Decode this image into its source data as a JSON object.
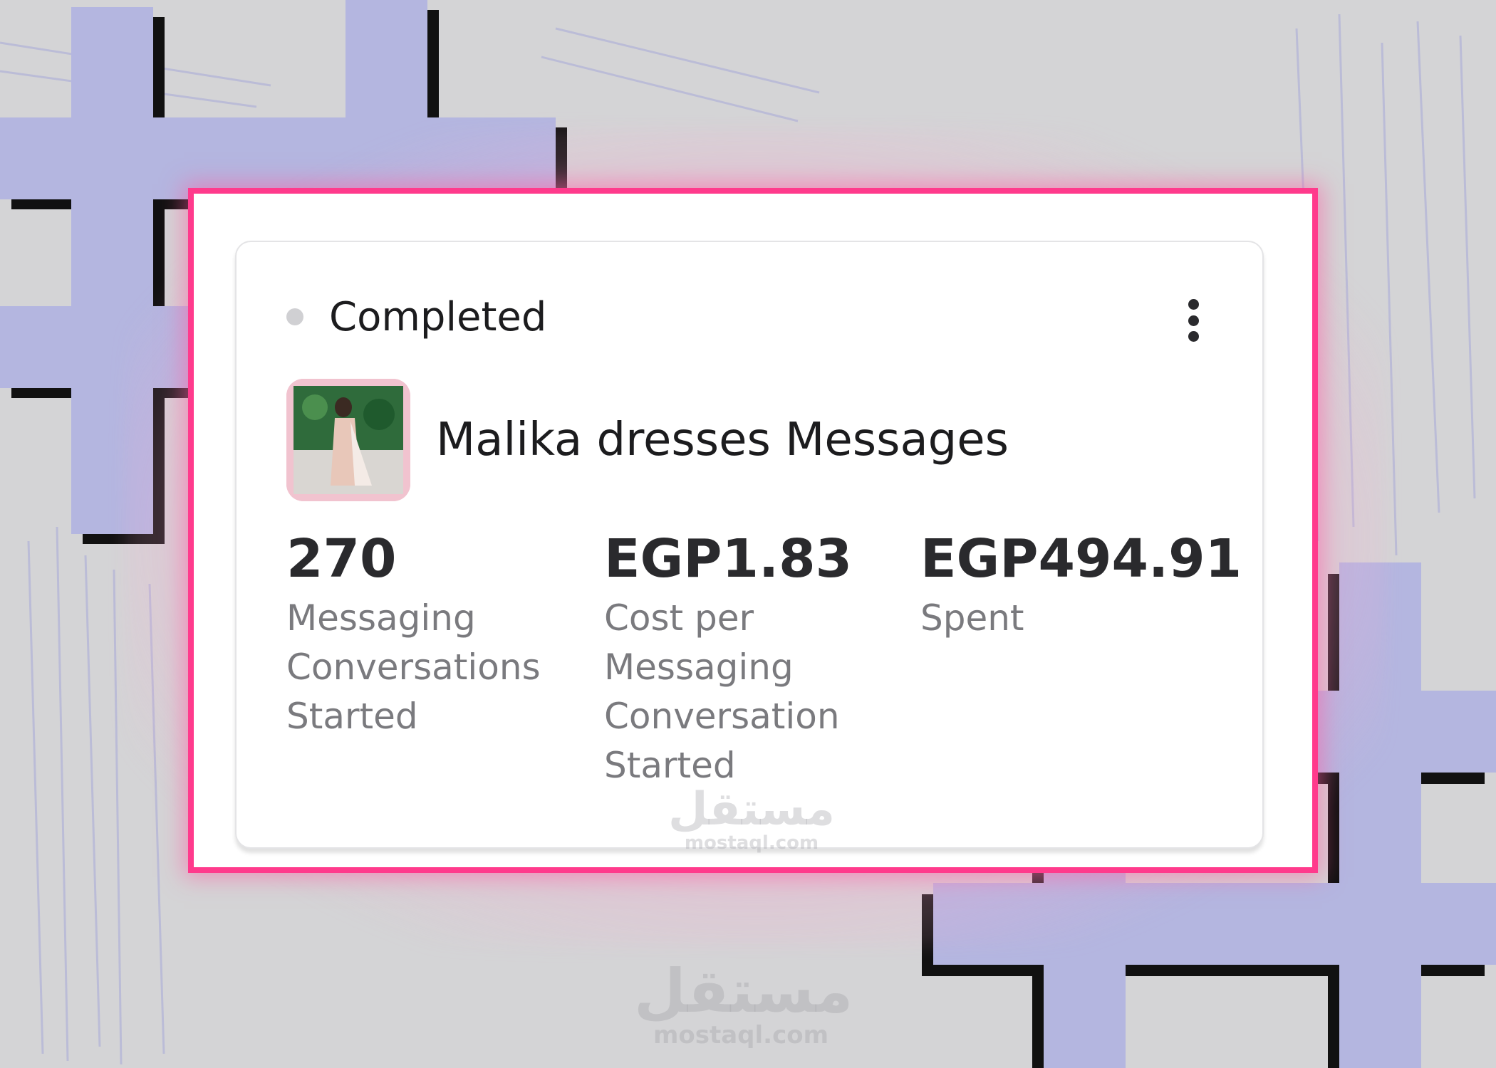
{
  "status": {
    "label": "Completed",
    "dot_color": "#d0d0d3"
  },
  "menu": {
    "icon": "more-vertical-icon"
  },
  "campaign": {
    "name": "Malika dresses Messages",
    "thumbnail": "dress-photo-thumbnail"
  },
  "metrics": [
    {
      "value": "270",
      "label": "Messaging Conversations Started"
    },
    {
      "value": "EGP1.83",
      "label": "Cost per Messaging Conversation Started"
    },
    {
      "value": "EGP494.91",
      "label": "Spent"
    }
  ],
  "watermark": {
    "arabic": "مستقل",
    "latin": "mostaql.com"
  },
  "colors": {
    "frame_accent": "#ff3a8c",
    "hash_color": "#b4b6e0",
    "background": "#d4d4d6"
  }
}
